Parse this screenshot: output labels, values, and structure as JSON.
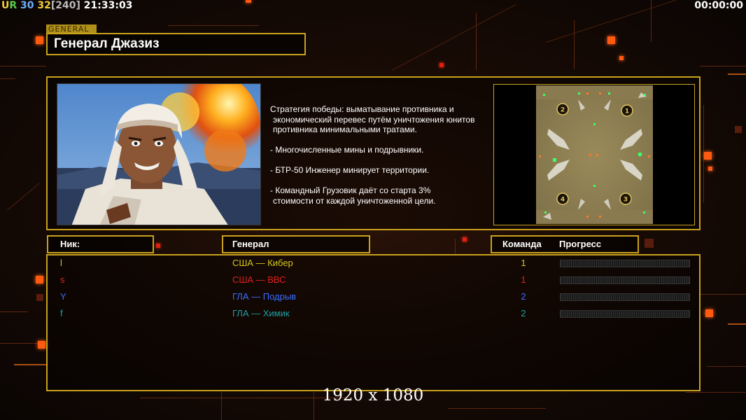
{
  "hud": {
    "left": {
      "part1": "U",
      "part1b": "R",
      "part2": "30",
      "part3": "32",
      "part4": "[240]",
      "part5": "21:33:03"
    },
    "right": "00:00:00"
  },
  "header": {
    "tag": "GENERAL",
    "title": "Генерал Джазиз"
  },
  "general_info": {
    "description": [
      [
        "Стратегия победы: выматывание противника и",
        " экономический перевес путём уничтожения юнитов",
        " противника минимальными тратами."
      ],
      [
        "- Многочисленные мины и подрывники."
      ],
      [
        "- БТР-50 Инженер минирует территории."
      ],
      [
        "- Командный Грузовик даёт со старта 3%",
        " стоимости от каждой уничтоженной цели."
      ]
    ],
    "map_positions": [
      "1",
      "2",
      "3",
      "4"
    ]
  },
  "table": {
    "headers": {
      "nick": "Ник:",
      "general": "Генерал",
      "team": "Команда",
      "progress": "Прогресс"
    },
    "players": [
      {
        "nick": "l",
        "general": "США — Кибер",
        "team": "1",
        "color": "#d6c81a",
        "progress": 0
      },
      {
        "nick": "s",
        "general": "США — ВВС",
        "team": "1",
        "color": "#e02020",
        "progress": 0
      },
      {
        "nick": "Y",
        "general": "ГЛА — Подрыв",
        "team": "2",
        "color": "#3a6cff",
        "progress": 0
      },
      {
        "nick": "f",
        "general": "ГЛА — Химик",
        "team": "2",
        "color": "#1ea0a0",
        "progress": 0
      }
    ]
  },
  "footer": {
    "resolution": "1920 x 1080"
  },
  "colors": {
    "accent": "#c9a11e",
    "background": "#160a05",
    "glow": "#ff5a10"
  },
  "icons": [
    "portrait-image",
    "minimap-image"
  ]
}
